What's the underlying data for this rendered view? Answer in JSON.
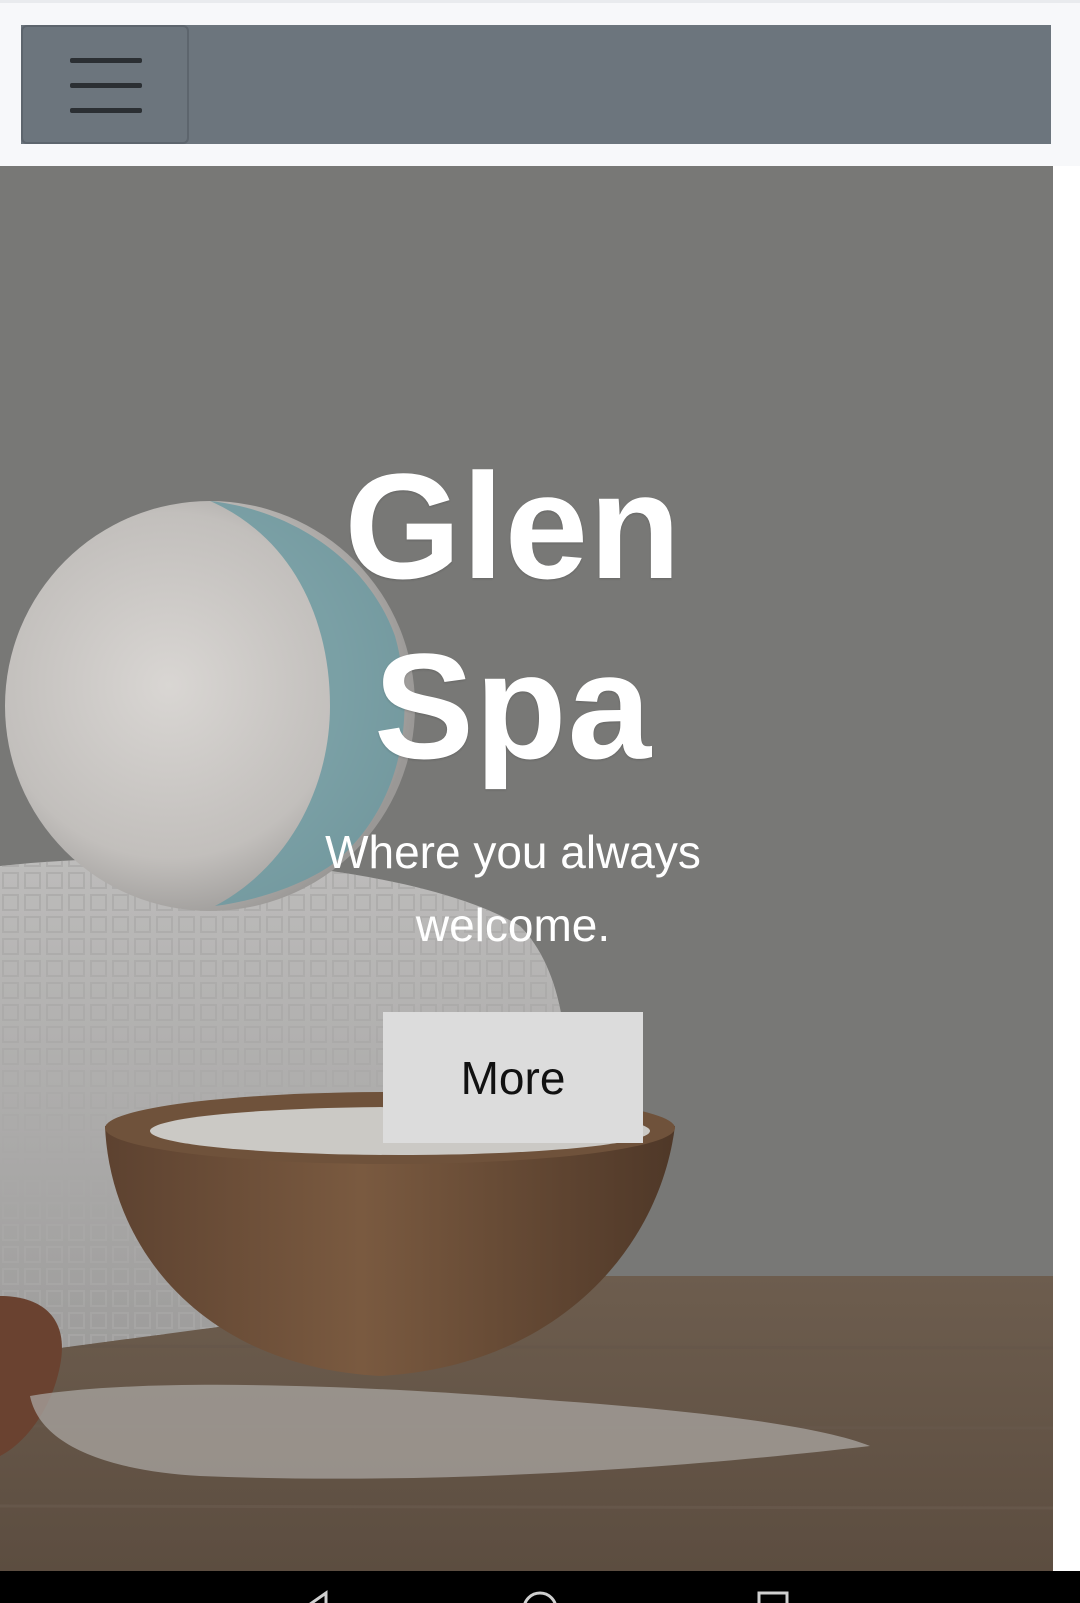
{
  "navbar": {
    "menu_icon": "hamburger-menu-icon",
    "background_color": "#6c757d",
    "toggle_icon_color": "#2b2f33"
  },
  "hero": {
    "title_line1": "Glen",
    "title_line2": "Spa",
    "subtitle": "Where you always welcome.",
    "button_label": "More",
    "button_color": "#dcdcdc",
    "text_color": "#ffffff"
  },
  "system_nav": {
    "back_icon": "back-triangle-icon",
    "home_icon": "home-circle-icon",
    "recents_icon": "recents-square-icon",
    "background_color": "#000000"
  }
}
